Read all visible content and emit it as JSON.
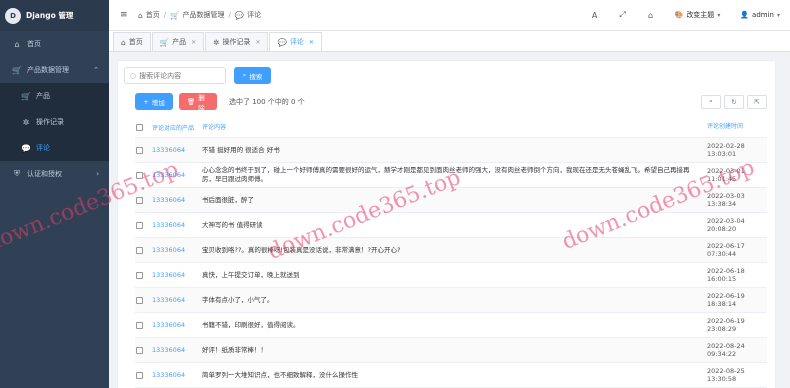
{
  "app": {
    "title": "Django 管理",
    "logo_glyph": "D"
  },
  "sidebar": {
    "items": [
      {
        "label": "首页",
        "icon": "home-icon"
      },
      {
        "label": "产品数据管理",
        "icon": "cart-icon"
      },
      {
        "label": "产品",
        "icon": "cart-icon"
      },
      {
        "label": "操作记录",
        "icon": "gear-icon"
      },
      {
        "label": "评论",
        "icon": "comments-icon",
        "active": true
      },
      {
        "label": "认证和授权",
        "icon": "shield-icon"
      }
    ]
  },
  "header": {
    "breadcrumb": [
      "首页",
      "产品数据管理",
      "评论"
    ],
    "theme_label": "改变主题",
    "user_label": "admin"
  },
  "tabs": [
    {
      "label": "首页"
    },
    {
      "label": "产品"
    },
    {
      "label": "操作记录"
    },
    {
      "label": "评论"
    }
  ],
  "search": {
    "placeholder": "搜索评论内容",
    "button": "搜索"
  },
  "toolbar": {
    "add_label": "增加",
    "delete_label": "删除",
    "selection_info": "选中了 100 个中的 0 个"
  },
  "table": {
    "columns": [
      "评论对应的产品",
      "评论内容",
      "评论创建时间"
    ],
    "rows": [
      {
        "product": "13336064",
        "content": "不错 挺好用的 很适合 好书",
        "date": "2022-02-28",
        "time": "13:03:01"
      },
      {
        "product": "13336064",
        "content": "心心念念的书终于到了，碰上一个好师傅真的需要很好的运气，赫学才刚是都见到面肉丝老师的强大，没有肉丝老师倒个方向，我现在还是无头苍蝇乱飞。希望自己再接再厉，早日跟过肉师傅。",
        "date": "2022-03-01",
        "time": "11:01:45"
      },
      {
        "product": "13336064",
        "content": "书后面很脏，醉了",
        "date": "2022-03-03",
        "time": "13:38:34"
      },
      {
        "product": "13336064",
        "content": "大神写的书 值得研读",
        "date": "2022-03-04",
        "time": "20:08:20"
      },
      {
        "product": "13336064",
        "content": "宝贝收到咯??。真的很棒呀!包装真是没话说，非常满意！?开心开心?",
        "date": "2022-06-17",
        "time": "07:30:44"
      },
      {
        "product": "13336064",
        "content": "真快，上午提交订单，晚上就送到",
        "date": "2022-06-18",
        "time": "16:00:15"
      },
      {
        "product": "13336064",
        "content": "字体有点小了，小气了。",
        "date": "2022-06-19",
        "time": "18:38:14"
      },
      {
        "product": "13336064",
        "content": "书籍不错，印刷很好，值得阅读。",
        "date": "2022-06-19",
        "time": "23:08:29"
      },
      {
        "product": "13336064",
        "content": "好评！纸质非常棒！！",
        "date": "2022-08-24",
        "time": "09:34:22"
      },
      {
        "product": "13336064",
        "content": "简单罗列一大堆知识点，也不细致解释，没什么操作性",
        "date": "2022-08-25",
        "time": "13:30:58"
      }
    ]
  },
  "watermark": {
    "left": "down.code365.top",
    "middle": "down.code365.top",
    "right": "down.code365.top",
    "color": "#e63c6e"
  },
  "colors": {
    "accent": "#409eff",
    "danger": "#f56c6c",
    "sidebar_bg": "#304156"
  }
}
